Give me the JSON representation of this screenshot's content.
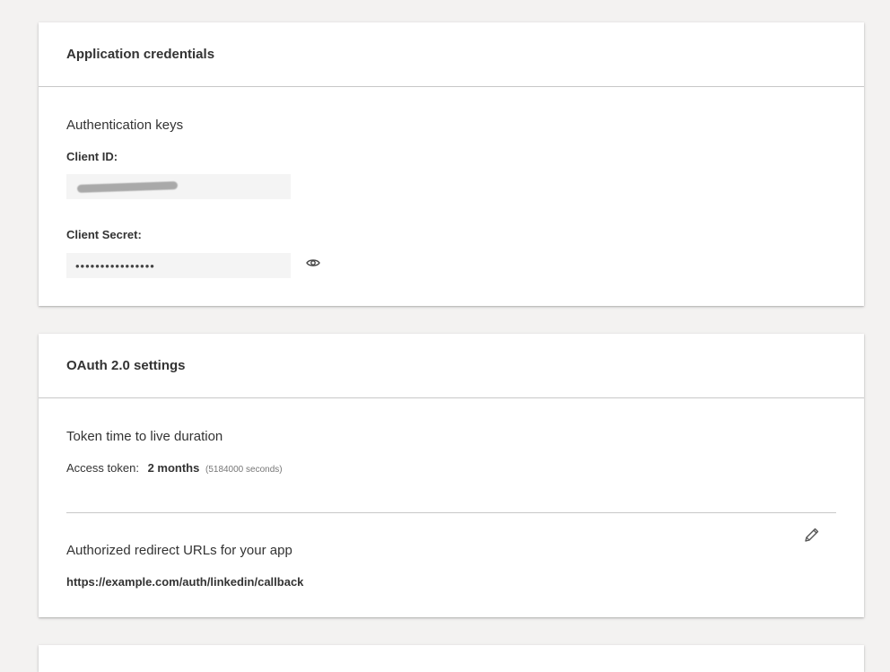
{
  "credentials": {
    "header": "Application credentials",
    "section_title": "Authentication keys",
    "client_id_label": "Client ID:",
    "client_id_value": "",
    "client_secret_label": "Client Secret:",
    "client_secret_value": "••••••••••••••••",
    "reveal_icon": "eye-icon"
  },
  "oauth": {
    "header": "OAuth 2.0 settings",
    "token_section_title": "Token time to live duration",
    "access_token_label": "Access token:",
    "access_token_value": "2 months",
    "access_token_seconds": "(5184000 seconds)",
    "redirect_section_title": "Authorized redirect URLs for your app",
    "redirect_url": "https://example.com/auth/linkedin/callback",
    "edit_icon": "pencil-icon"
  }
}
